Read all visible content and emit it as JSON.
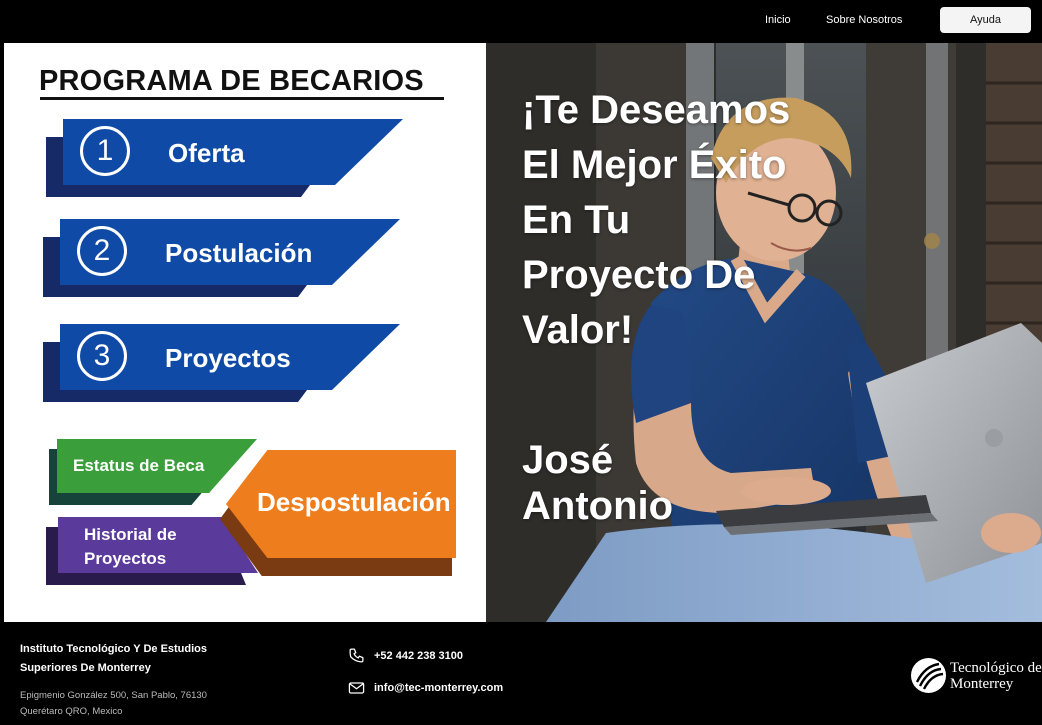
{
  "nav": {
    "inicio": "Inicio",
    "sobre": "Sobre Nosotros",
    "ayuda": "Ayuda"
  },
  "program": {
    "title": "PROGRAMA DE BECARIOS",
    "steps": [
      {
        "number": "1",
        "label": "Oferta"
      },
      {
        "number": "2",
        "label": "Postulación"
      },
      {
        "number": "3",
        "label": "Proyectos"
      }
    ],
    "estatus": "Estatus de Beca",
    "historial": "Historial de Proyectos",
    "despostulacion": "Despostulación",
    "colors": {
      "blue": "#0f4aa6",
      "green": "#3a9e3a",
      "purple": "#5a3a9a",
      "orange": "#ee7d1e"
    }
  },
  "hero": {
    "message": "¡Te Deseamos El Mejor Éxito En Tu Proyecto De Valor!",
    "name": "José Antonio"
  },
  "footer": {
    "institution": "Instituto Tecnológico Y De Estudios Superiores De Monterrey",
    "address": "Epigmenio González 500, San Pablo, 76130 Querétaro QRO, Mexico",
    "phone": "+52 442 238 3100",
    "email": "info@tec-monterrey.com",
    "logo_text": "Tecnológico de Monterrey",
    "phone_icon": "phone-icon",
    "mail_icon": "mail-icon"
  }
}
